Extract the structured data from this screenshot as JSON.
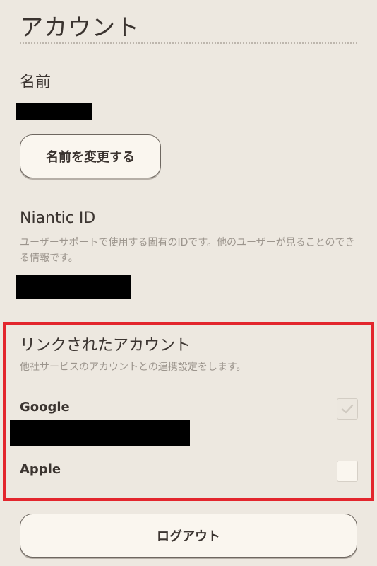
{
  "page": {
    "title": "アカウント"
  },
  "name_section": {
    "heading": "名前",
    "change_button_label": "名前を変更する"
  },
  "niantic_id_section": {
    "heading": "Niantic ID",
    "description": "ユーザーサポートで使用する固有のIDです。他のユーザーが見ることのできる情報です。"
  },
  "linked_accounts": {
    "heading": "リンクされたアカウント",
    "description": "他社サービスのアカウントとの連携設定をします。",
    "providers": [
      {
        "label": "Google",
        "linked": true
      },
      {
        "label": "Apple",
        "linked": false
      }
    ]
  },
  "logout": {
    "label": "ログアウト"
  },
  "colors": {
    "background": "#ede8e0",
    "highlight_border": "#e3262d",
    "text_primary": "#3b3430",
    "text_secondary": "#9c958d",
    "button_fill": "#faf6ef"
  },
  "icons": {
    "google_checkbox": "checkmark-icon"
  }
}
